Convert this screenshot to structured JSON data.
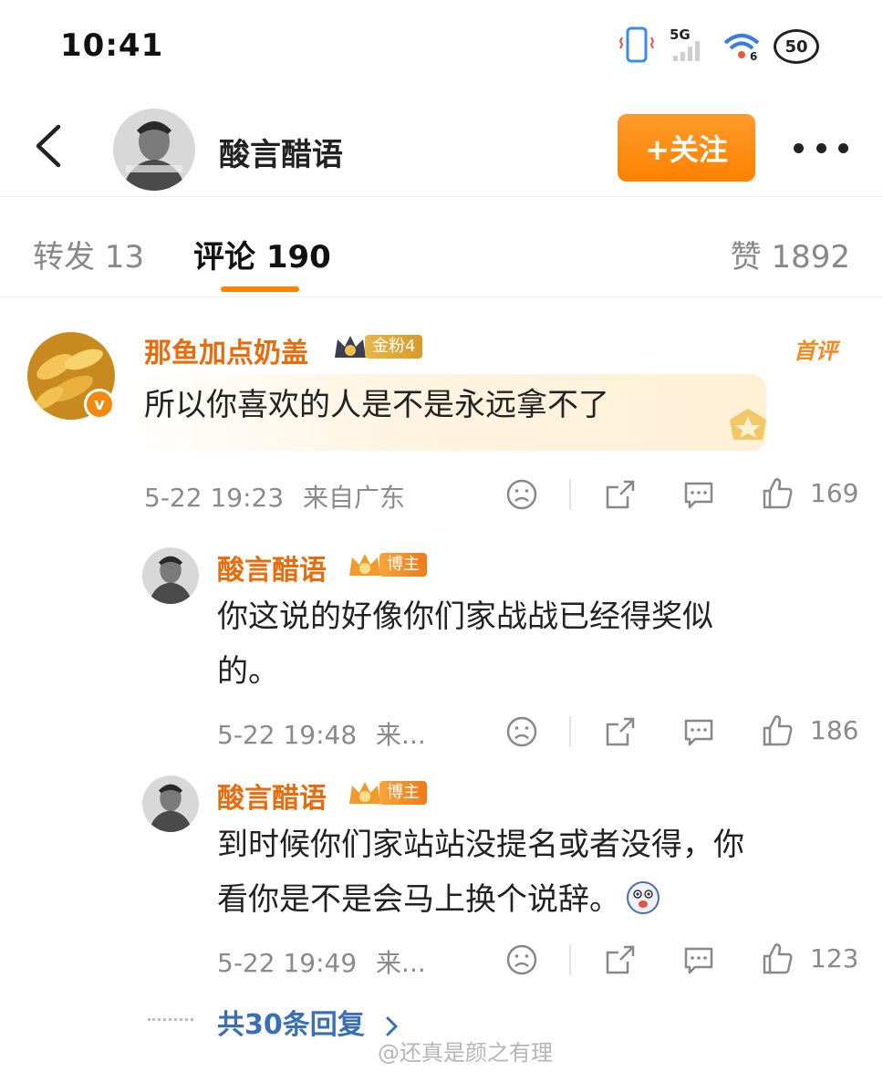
{
  "status_bar": {
    "time": "10:41",
    "network": "5G",
    "wifi_badge": "6",
    "battery": "50"
  },
  "header": {
    "username": "酸言醋语",
    "follow_label": "+关注",
    "accent_color": "#ff8200"
  },
  "tabs": [
    {
      "label": "转发 13",
      "active": false
    },
    {
      "label": "评论 190",
      "active": true
    },
    {
      "label": "赞 1892",
      "active": false
    }
  ],
  "main_comment": {
    "username": "那鱼加点奶盖",
    "badge": "金粉4",
    "first_label": "首评",
    "text": "所以你喜欢的人是不是永远拿不了",
    "timestamp": "5-22 19:23",
    "location": "来自广东",
    "likes": "169"
  },
  "replies": [
    {
      "username": "酸言醋语",
      "badge": "博主",
      "text_line1": "你这说的好像你们家战战已经得奖似",
      "text_line2": "的。",
      "timestamp": "5-22 19:48",
      "location": "来...",
      "likes": "186"
    },
    {
      "username": "酸言醋语",
      "badge": "博主",
      "text_line1": "到时候你们家站站没提名或者没得，你",
      "text_line2": "看你是不是会马上换个说辞。",
      "timestamp": "5-22 19:49",
      "location": "来...",
      "likes": "123"
    }
  ],
  "more_replies": "共30条回复",
  "watermark": "@还真是颜之有理",
  "icons": [
    "back-icon",
    "more-icon",
    "dislike-icon",
    "share-icon",
    "comment-icon",
    "like-icon",
    "crown-icon",
    "verified-icon",
    "emoji-icon",
    "chevron-right-icon"
  ]
}
